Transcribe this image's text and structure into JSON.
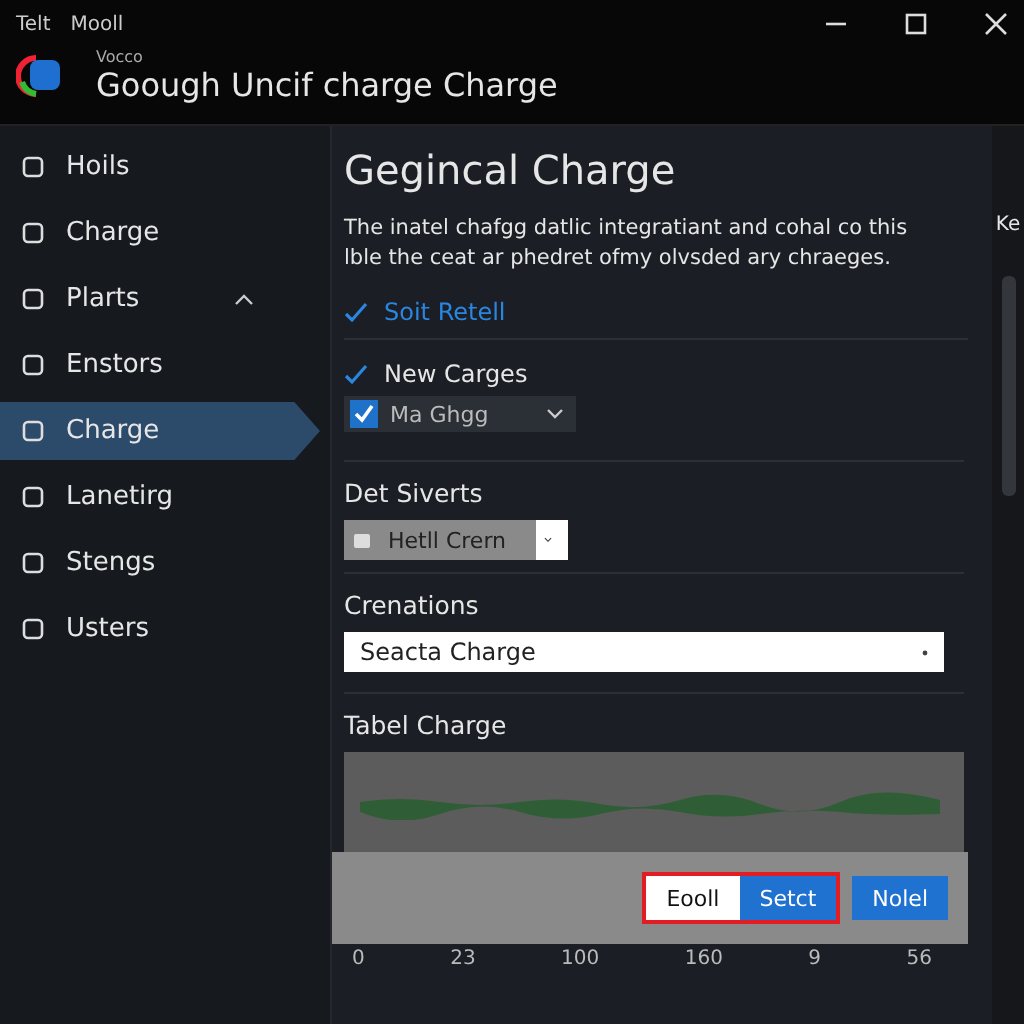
{
  "menu": [
    "Telt",
    "Mooll"
  ],
  "app": {
    "subtitle": "Vocco",
    "title": "Goough Uncif charge Charge"
  },
  "sidebar": {
    "items": [
      {
        "label": "Hoils",
        "selected": false
      },
      {
        "label": "Charge",
        "selected": false
      },
      {
        "label": "Plarts",
        "selected": false,
        "expanded": true
      },
      {
        "label": "Enstors",
        "selected": false
      },
      {
        "label": "Charge",
        "selected": true
      },
      {
        "label": "Lanetirg",
        "selected": false
      },
      {
        "label": "Stengs",
        "selected": false
      },
      {
        "label": "Usters",
        "selected": false
      }
    ]
  },
  "main": {
    "heading": "Gegincal Charge",
    "description": "The inatel chafgg datlic integratiant and cohal co this lble the ceat ar phedret ofmy olvsded ary chraeges.",
    "options": [
      {
        "label": "Soit Retell",
        "checked": true
      },
      {
        "label": "New Carges",
        "checked": true
      }
    ],
    "combo": {
      "value": "Ma Ghgg",
      "checked": true
    },
    "device": {
      "label": "Det Siverts",
      "value": "Hetll Crern"
    },
    "select": {
      "label": "Crenations",
      "value": "Seacta Charge"
    },
    "chart": {
      "title": "Tabel Charge",
      "axis_labels": [
        "0",
        "23",
        "100",
        "160",
        "9",
        "56"
      ]
    },
    "buttons": [
      {
        "label": "Eooll",
        "kind": "secondary"
      },
      {
        "label": "Setct",
        "kind": "primary"
      },
      {
        "label": "Nolel",
        "kind": "primary"
      }
    ],
    "side_label": "Ke"
  }
}
